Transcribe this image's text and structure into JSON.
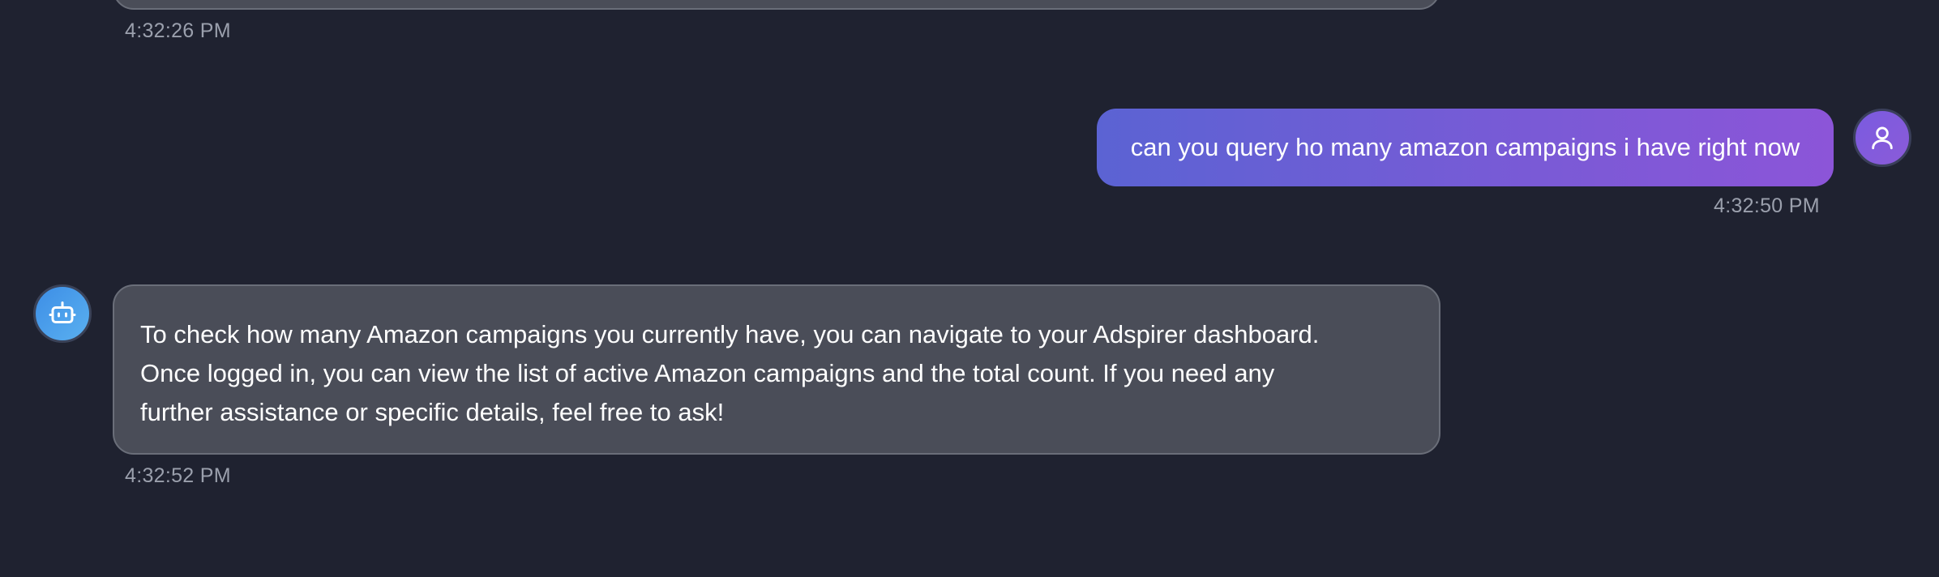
{
  "messages": {
    "previous": {
      "timestamp": "4:32:26 PM"
    },
    "user": {
      "text": "can you query ho many amazon campaigns i have right now",
      "timestamp": "4:32:50 PM",
      "avatar_icon": "user-icon"
    },
    "assistant": {
      "lines": [
        "To check how many Amazon campaigns you currently have, you can navigate to your Adspirer dashboard.",
        "Once logged in, you can view the list of active Amazon campaigns and the total count. If you need any",
        "further assistance or specific details, feel free to ask!"
      ],
      "timestamp": "4:32:52 PM",
      "avatar_icon": "bot-icon"
    }
  },
  "colors": {
    "background": "#1f2230",
    "assistant_bubble": "#4a4d58",
    "user_bubble_start": "#5b63d3",
    "user_bubble_end": "#8c55d8",
    "timestamp": "#9ba0ad"
  }
}
